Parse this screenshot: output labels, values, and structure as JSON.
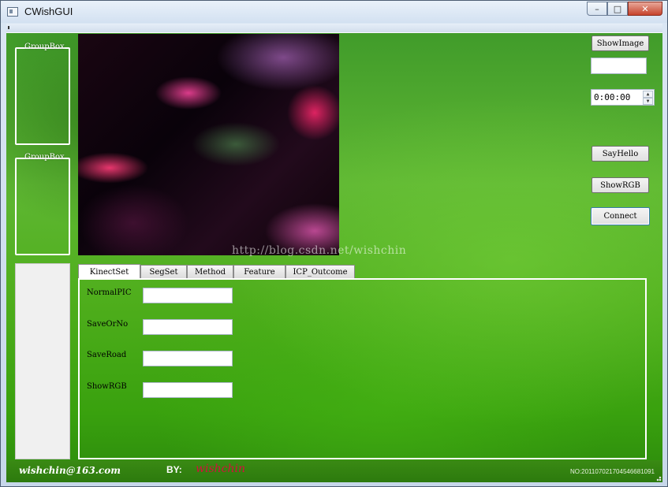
{
  "window": {
    "title": "CWishGUI",
    "icon": "app-window-icon",
    "controls": {
      "minimize": "–",
      "maximize": "□",
      "close": "✕"
    }
  },
  "menubar": {
    "grip": "⁞"
  },
  "groupboxes": [
    {
      "title": "GroupBox"
    },
    {
      "title": "GroupBox"
    }
  ],
  "right_panel": {
    "show_image_label": "ShowImage",
    "text_field_value": "",
    "time_value": "0:00:00",
    "spin_up": "▲",
    "spin_down": "▼",
    "say_hello_label": "SayHello",
    "show_rgb_label": "ShowRGB",
    "connect_label": "Connect"
  },
  "tabs": [
    {
      "label": "KinectSet",
      "active": true
    },
    {
      "label": "SegSet",
      "active": false
    },
    {
      "label": "Method",
      "active": false
    },
    {
      "label": "Feature",
      "active": false
    },
    {
      "label": "ICP_Outcome",
      "active": false
    }
  ],
  "kinect_form": {
    "fields": [
      {
        "label": "NormalPIC",
        "value": ""
      },
      {
        "label": "SaveOrNo",
        "value": ""
      },
      {
        "label": "SaveRoad",
        "value": ""
      },
      {
        "label": "ShowRGB",
        "value": ""
      }
    ]
  },
  "watermark": "http://blog.csdn.net/wishchin",
  "status": {
    "email": "wishchin@163.com",
    "by": "BY:",
    "author": "wishchin",
    "number": "NO:201107021704546681091"
  },
  "colors": {
    "background_green": "#4fae1c",
    "author_red": "#d4103c",
    "close_red": "#c7432c"
  }
}
